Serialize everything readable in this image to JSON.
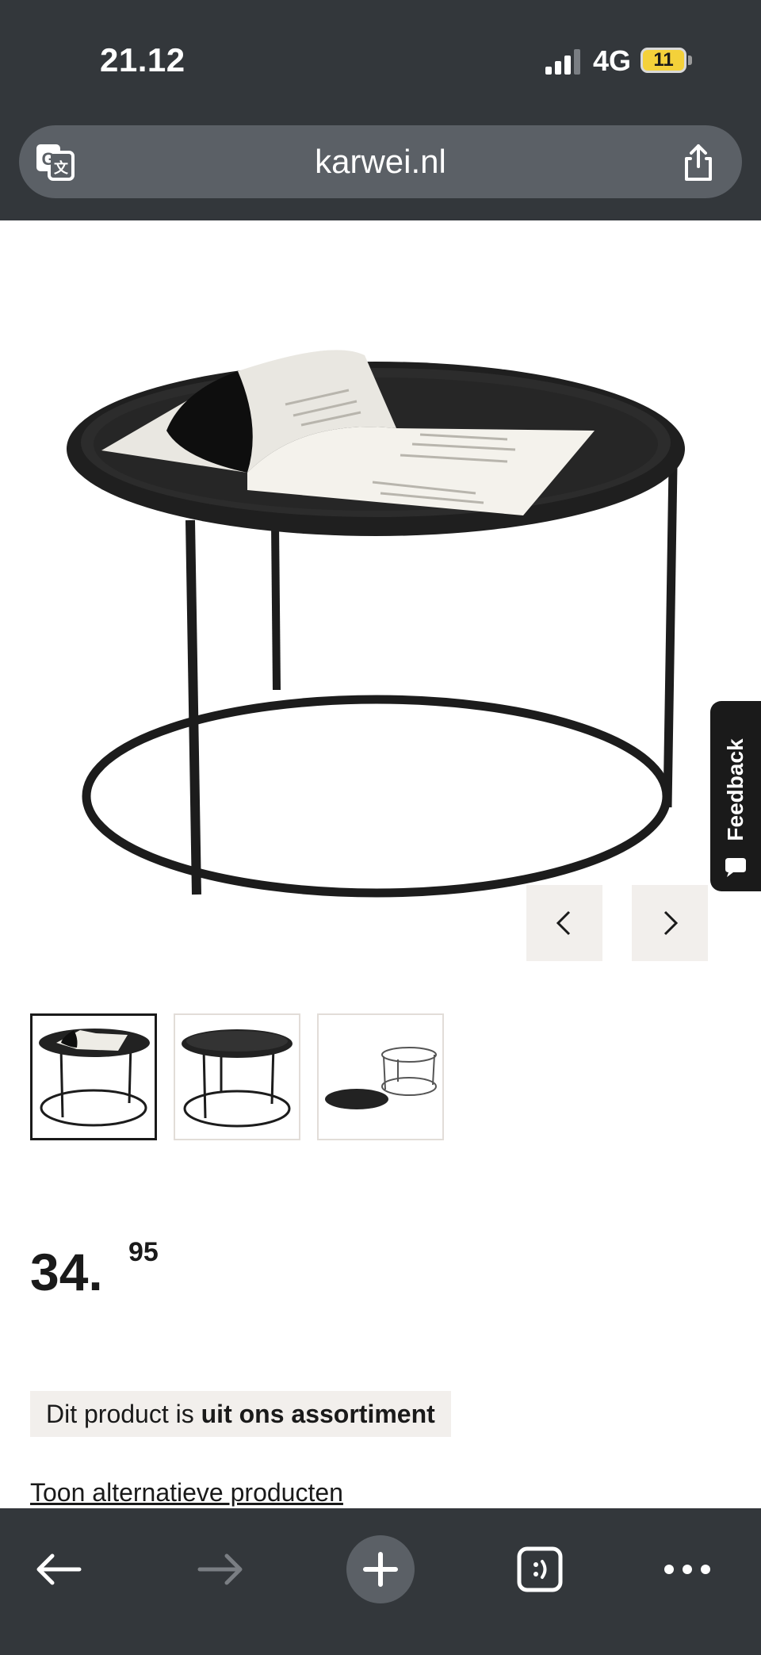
{
  "status_bar": {
    "time": "21.12",
    "network": "4G",
    "battery": "11"
  },
  "browser": {
    "url": "karwei.nl"
  },
  "product": {
    "price_whole": "34.",
    "price_cents": "95",
    "availability_prefix": "Dit product is ",
    "availability_status": "uit ons assortiment",
    "alternatives_link": "Toon alternatieve producten"
  },
  "gallery": {
    "thumbnail_count": 3,
    "active_thumbnail": 1
  },
  "feedback_tab": {
    "label": "Feedback"
  },
  "colors": {
    "chrome": "#33373b",
    "url_bar": "#5b6066",
    "accent_battery": "#f4d13a",
    "notice_bg": "#f2efec"
  },
  "icons": [
    "signal-icon",
    "battery-icon",
    "translate-icon",
    "share-icon",
    "chevron-left-icon",
    "chevron-right-icon",
    "chat-bubble-icon",
    "back-arrow-icon",
    "forward-arrow-icon",
    "plus-icon",
    "tabs-icon",
    "more-icon"
  ]
}
